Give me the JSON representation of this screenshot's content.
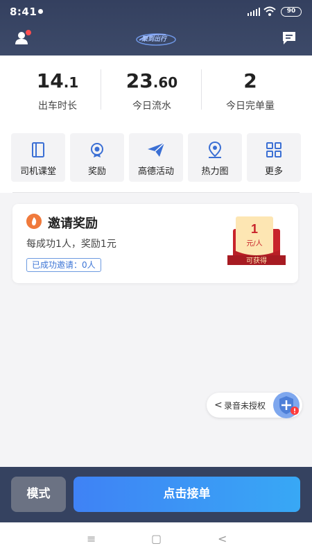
{
  "status": {
    "time": "8:41",
    "battery": "90"
  },
  "header": {
    "logo_text": "聚到出行",
    "profile_icon": "person-icon",
    "message_icon": "chat-icon"
  },
  "stats": [
    {
      "main": "14",
      "decimal": ".1",
      "label": "出车时长"
    },
    {
      "main": "23",
      "decimal": ".60",
      "label": "今日流水"
    },
    {
      "main": "2",
      "decimal": "",
      "label": "今日完单量"
    }
  ],
  "tools": [
    {
      "label": "司机课堂",
      "icon": "book-icon"
    },
    {
      "label": "奖励",
      "icon": "medal-icon"
    },
    {
      "label": "高德活动",
      "icon": "paper-plane-icon"
    },
    {
      "label": "热力图",
      "icon": "map-pin-icon"
    },
    {
      "label": "更多",
      "icon": "grid-icon"
    }
  ],
  "invite": {
    "title": "邀请奖励",
    "desc": "每成功1人，奖励1元",
    "badge": "已成功邀请：0人",
    "envelope_amount": "1",
    "envelope_unit": "元/人",
    "envelope_ribbon": "可获得"
  },
  "record": {
    "text": "录音未授权",
    "chevron": "<"
  },
  "bottom": {
    "mode_label": "模式",
    "accept_label": "点击接单"
  },
  "android_nav": {
    "menu": "≡",
    "home": "▢",
    "back": "<"
  },
  "colors": {
    "header": "#34405f",
    "accent": "#3f82f5",
    "invite_icon": "#f07a3c"
  }
}
